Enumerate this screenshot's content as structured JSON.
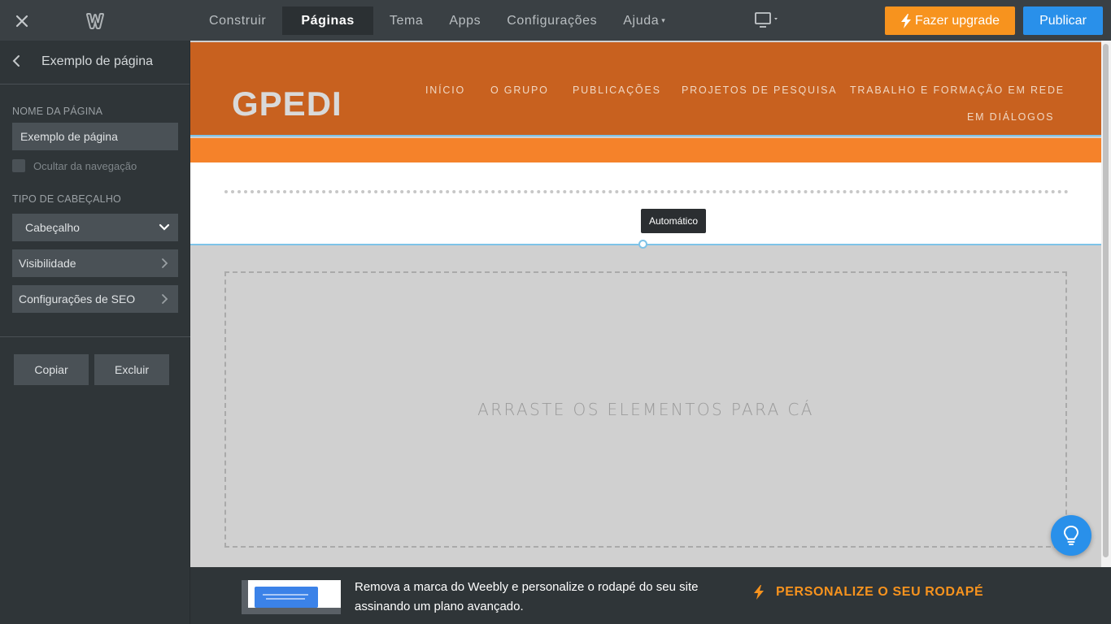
{
  "topbar": {
    "nav": [
      "Construir",
      "Páginas",
      "Tema",
      "Apps",
      "Configurações",
      "Ajuda"
    ],
    "active_tab": "Páginas",
    "upgrade_label": "Fazer upgrade",
    "publish_label": "Publicar",
    "icons": {
      "close": "close-icon",
      "logo": "weebly-logo",
      "device": "desktop-icon",
      "upgrade": "bolt-icon"
    },
    "colors": {
      "upgrade": "#f7931e",
      "publish": "#2990ea"
    }
  },
  "sidebar": {
    "page_title": "Exemplo de página",
    "page_name_label": "NOME DA PÁGINA",
    "page_name_value": "Exemplo de página",
    "hide_nav_label": "Ocultar da navegação",
    "hide_nav_checked": false,
    "header_type_label": "TIPO DE CABEÇALHO",
    "header_type_value": "Cabeçalho",
    "visibility_label": "Visibilidade",
    "seo_label": "Configurações de SEO",
    "copy_label": "Copiar",
    "delete_label": "Excluir"
  },
  "site": {
    "title": "GPEDI",
    "nav": [
      "INÍCIO",
      "O GRUPO",
      "PUBLICAÇÕES",
      "PROJETOS DE PESQUISA",
      "TRABALHO E FORMAÇÃO EM REDE",
      "EM DIÁLOGOS"
    ],
    "header_color": "#c8611f",
    "band_color": "#f5822a"
  },
  "canvas": {
    "tooltip": "Automático",
    "drop_text": "ARRASTE OS ELEMENTOS PARA CÁ"
  },
  "footer": {
    "promo_text": "Remova a marca do Weebly e personalize o rodapé do seu site assinando um plano avançado.",
    "promo_link": "PERSONALIZE O SEU RODAPÉ"
  }
}
